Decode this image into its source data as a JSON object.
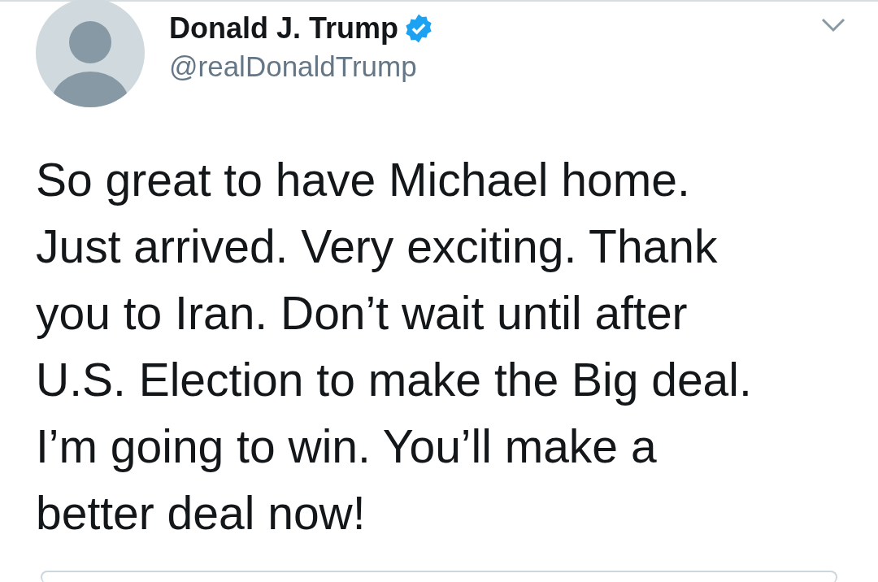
{
  "tweet": {
    "name": "Donald J. Trump",
    "verified": true,
    "handle": "@realDonaldTrump",
    "text": "So great to have Michael home.\nJust arrived. Very exciting. Thank\nyou to Iran. Don’t wait until after\nU.S. Election to make the Big deal.\nI’m going to win. You’ll make a\nbetter deal now!"
  }
}
